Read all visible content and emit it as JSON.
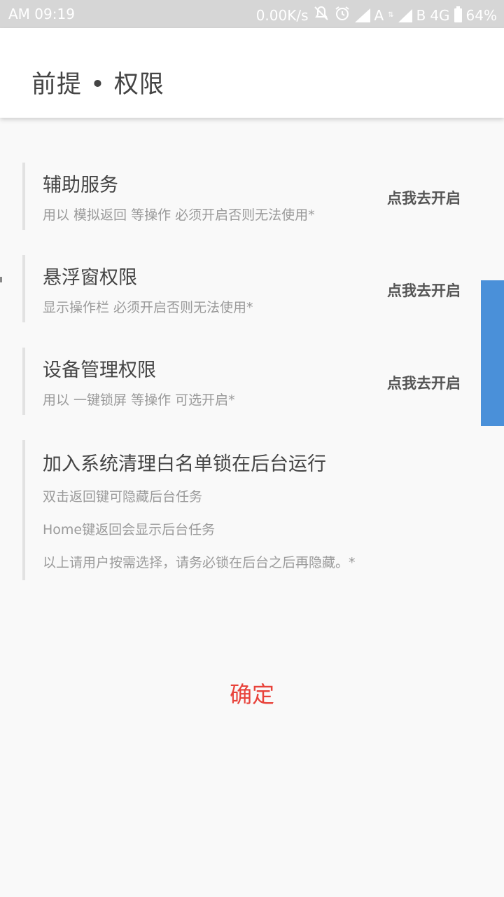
{
  "status_bar": {
    "ampm": "AM",
    "time": "09:19",
    "net_speed": "0.00K/s",
    "sim_a": "A",
    "sim_b": "B",
    "network": "4G",
    "battery": "64%"
  },
  "header": {
    "title": "前提 • 权限"
  },
  "items": [
    {
      "title": "辅助服务",
      "desc": "用以 模拟返回 等操作   必须开启否则无法使用*",
      "action": "点我去开启"
    },
    {
      "title": "悬浮窗权限",
      "desc": "显示操作栏  必须开启否则无法使用*",
      "action": "点我去开启"
    },
    {
      "title": "设备管理权限",
      "desc": "用以 一键锁屏 等操作   可选开启*",
      "action": "点我去开启"
    },
    {
      "title": "加入系统清理白名单锁在后台运行",
      "lines": [
        "双击返回键可隐藏后台任务",
        "Home键返回会显示后台任务",
        "以上请用户按需选择，请务必锁在后台之后再隐藏。*"
      ]
    }
  ],
  "footer": {
    "confirm_label": "确定"
  },
  "colors": {
    "accent_red": "#e8423a",
    "side_tab_blue": "#4a90d9",
    "status_bar_bg": "#d6d6d6"
  },
  "icons": {
    "status_bar": [
      "mute-icon",
      "alarm-icon",
      "signal-icon",
      "data-arrows-icon",
      "signal-icon",
      "battery-icon"
    ]
  }
}
